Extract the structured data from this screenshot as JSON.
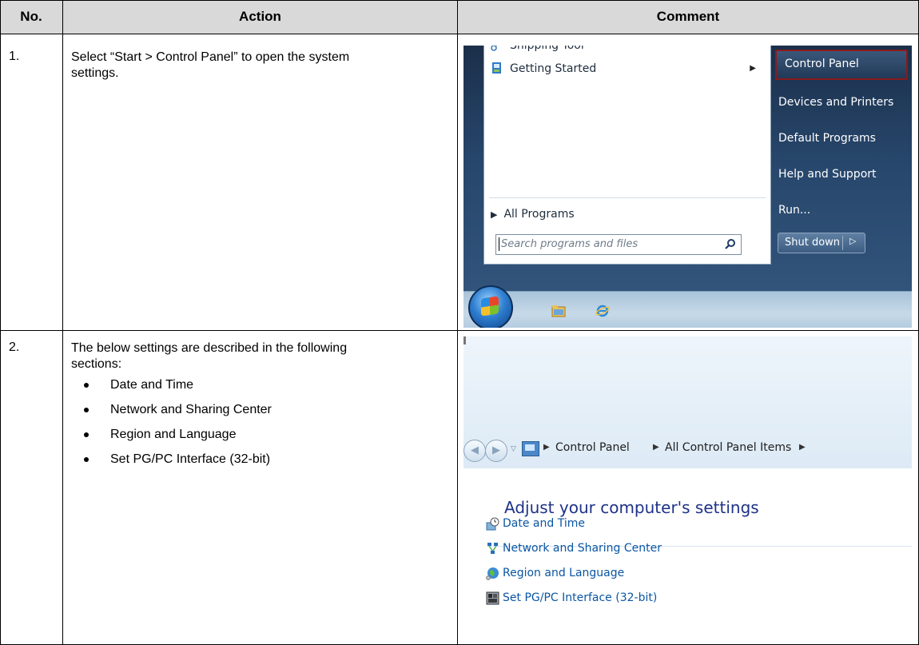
{
  "table": {
    "headers": [
      "No.",
      "Action",
      "Comment"
    ],
    "rows": [
      {
        "no": "1.",
        "action_text": "Select “Start > Control Panel” to open the system settings.",
        "bullets": []
      },
      {
        "no": "2.",
        "action_text": "The below settings are described in the following sections:",
        "bullets": [
          "Date and Time",
          "Network and Sharing Center",
          "Region and Language",
          "Set PG/PC Interface (32-bit)"
        ]
      }
    ]
  },
  "start_menu": {
    "pinned": [
      {
        "label": "Snipping Tool",
        "icon": "scissors-icon"
      },
      {
        "label": "Getting Started",
        "icon": "getting-started-icon"
      }
    ],
    "all_programs": "All Programs",
    "search_placeholder": "Search programs and files",
    "right_items": [
      "Control Panel",
      "Devices and Printers",
      "Default Programs",
      "Help and Support",
      "Run..."
    ],
    "shutdown_label": "Shut down",
    "highlight_color": "#8b1a1a"
  },
  "control_panel": {
    "breadcrumb": [
      "Control Panel",
      "All Control Panel Items"
    ],
    "heading": "Adjust your computer's settings",
    "items": [
      {
        "label": "Date and Time",
        "icon": "clock-calendar-icon"
      },
      {
        "label": "Network and Sharing Center",
        "icon": "network-icon"
      },
      {
        "label": "Region and Language",
        "icon": "globe-icon"
      },
      {
        "label": "Set PG/PC Interface (32-bit)",
        "icon": "pg-pc-interface-icon"
      }
    ],
    "link_color": "#0a55a3"
  }
}
